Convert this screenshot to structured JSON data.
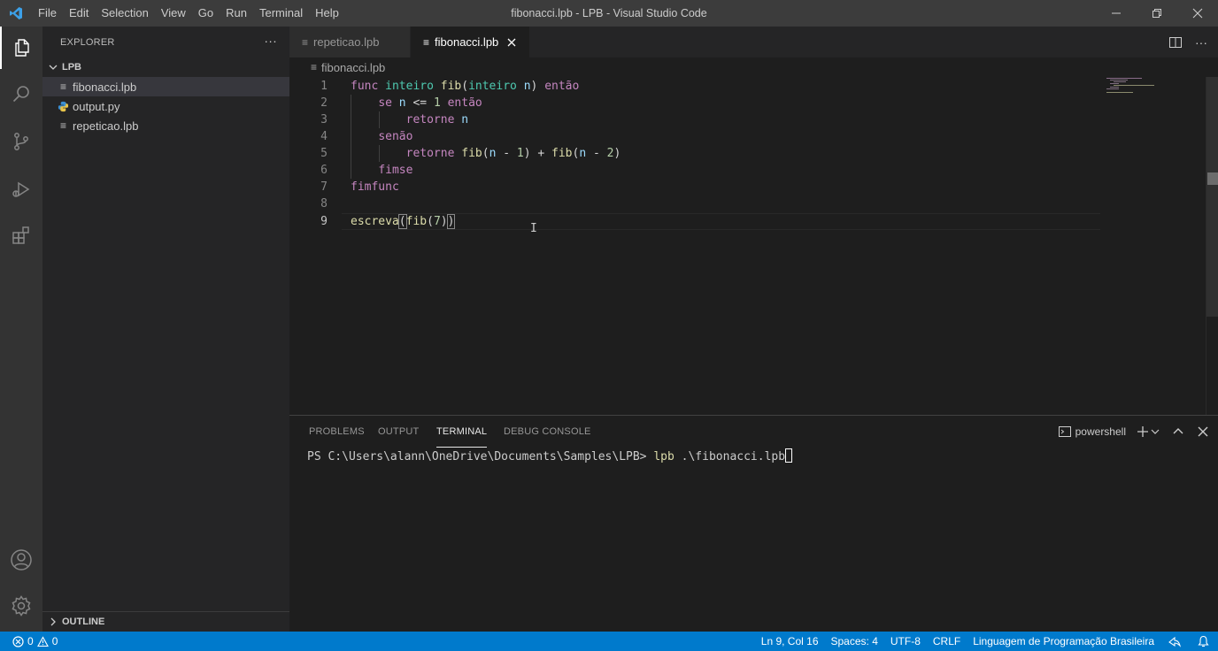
{
  "window": {
    "title": "fibonacci.lpb - LPB - Visual Studio Code",
    "menu": [
      "File",
      "Edit",
      "Selection",
      "View",
      "Go",
      "Run",
      "Terminal",
      "Help"
    ]
  },
  "sidebar": {
    "title": "EXPLORER",
    "folder": "LPB",
    "files": [
      "fibonacci.lpb",
      "output.py",
      "repeticao.lpb"
    ],
    "outline": "OUTLINE"
  },
  "tabs": [
    {
      "label": "repeticao.lpb"
    },
    {
      "label": "fibonacci.lpb"
    }
  ],
  "breadcrumb": "fibonacci.lpb",
  "editor": {
    "line_numbers": [
      "1",
      "2",
      "3",
      "4",
      "5",
      "6",
      "7",
      "8",
      "9"
    ]
  },
  "panel": {
    "tabs": [
      "PROBLEMS",
      "OUTPUT",
      "TERMINAL",
      "DEBUG CONSOLE"
    ],
    "shell": "powershell",
    "prompt": "PS C:\\Users\\alann\\OneDrive\\Documents\\Samples\\LPB> ",
    "command": "lpb",
    "args": " .\\fibonacci.lpb"
  },
  "statusbar": {
    "errors": "0",
    "warnings": "0",
    "position": "Ln 9, Col 16",
    "spaces": "Spaces: 4",
    "encoding": "UTF-8",
    "eol": "CRLF",
    "language": "Linguagem de Programação Brasileira"
  },
  "colors": {
    "accent": "#007acc",
    "keyword": "#c586c0",
    "function": "#dcdcaa",
    "type": "#4ec9b0",
    "number": "#b5cea8"
  }
}
